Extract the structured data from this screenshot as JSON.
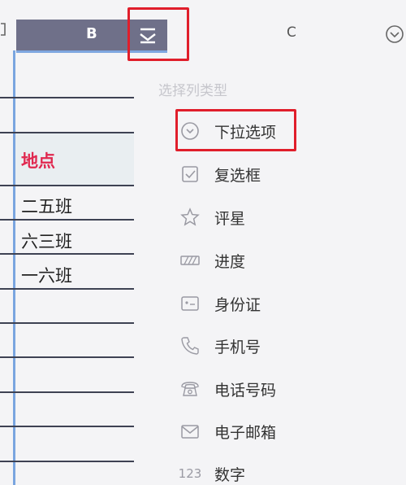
{
  "columns": {
    "b_label": "B",
    "c_label": "C"
  },
  "cells": [
    "地点",
    "二五班",
    "六三班",
    "一六班"
  ],
  "panel": {
    "title": "选择列类型",
    "items": [
      {
        "label": "下拉选项",
        "icon": "dropdown-circle-icon"
      },
      {
        "label": "复选框",
        "icon": "checkbox-icon"
      },
      {
        "label": "评星",
        "icon": "star-icon"
      },
      {
        "label": "进度",
        "icon": "progress-icon"
      },
      {
        "label": "身份证",
        "icon": "id-card-icon"
      },
      {
        "label": "手机号",
        "icon": "phone-icon"
      },
      {
        "label": "电话号码",
        "icon": "telephone-icon"
      },
      {
        "label": "电子邮箱",
        "icon": "mail-icon"
      },
      {
        "label": "数字",
        "icon": "number-icon",
        "glyph": "123"
      }
    ]
  },
  "colors": {
    "header_bg": "#6f7089",
    "accent_red": "#e0284f",
    "highlight": "#e01e2b",
    "selection_blue": "#7aa5df"
  }
}
